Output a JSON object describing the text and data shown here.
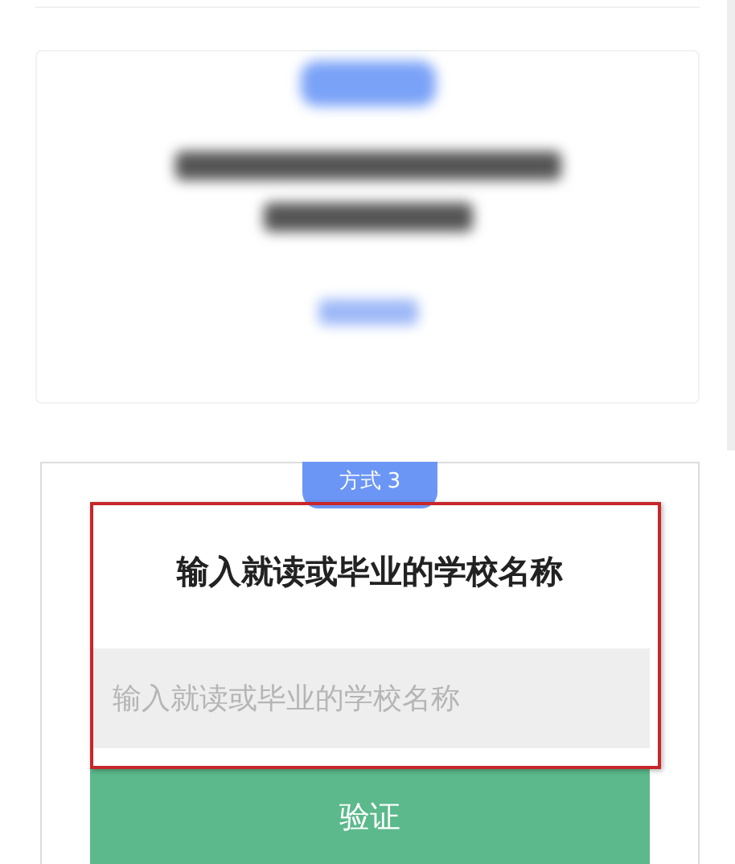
{
  "previous_card": {
    "blurred": true
  },
  "method_card": {
    "badge": "方式 3",
    "title": "输入就读或毕业的学校名称",
    "school_field": {
      "placeholder": "输入就读或毕业的学校名称"
    },
    "verify_button": "验证",
    "highlighted": true
  }
}
